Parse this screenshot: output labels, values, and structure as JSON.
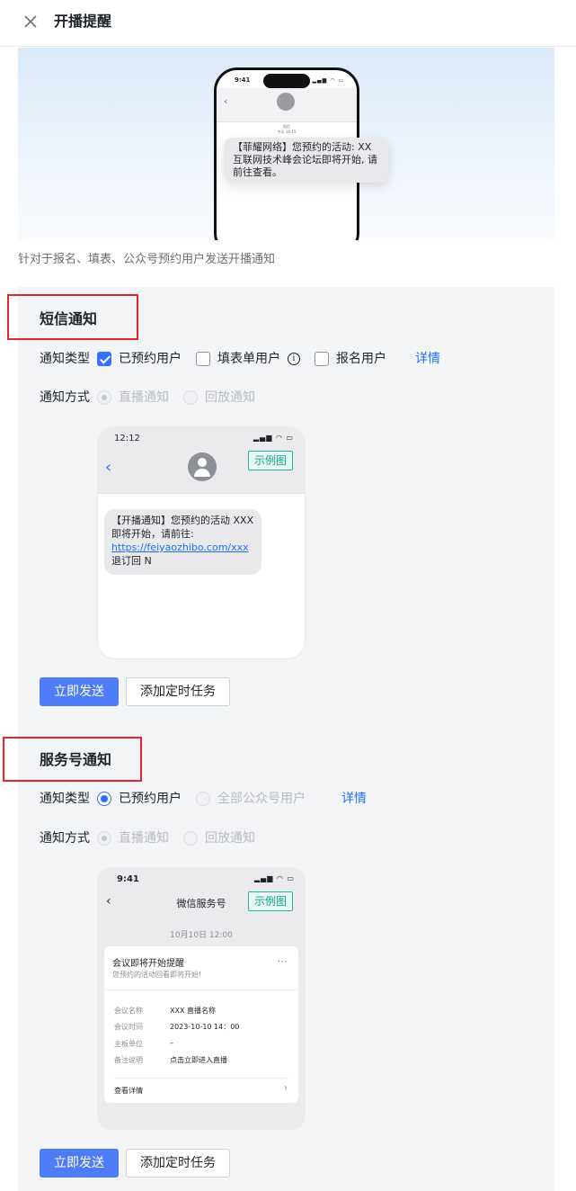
{
  "header": {
    "title": "开播提醒"
  },
  "banner": {
    "phone_time": "9:41",
    "signal_icons": "▂▄▆ ◠ ▭",
    "sender": "短信\n今天 14:15",
    "message": "【菲耀网络】您预约的活动: XX 互联网技术峰会论坛即将开始, 请前往查看。"
  },
  "subtitle": "针对于报名、填表、公众号预约用户发送开播通知",
  "sms": {
    "title": "短信通知",
    "type_label": "通知类型",
    "types": [
      {
        "label": "已预约用户",
        "checked": true
      },
      {
        "label": "填表单用户",
        "checked": false
      },
      {
        "label": "报名用户",
        "checked": false
      }
    ],
    "detail_link": "详情",
    "method_label": "通知方式",
    "methods": [
      {
        "label": "直播通知",
        "selected": true,
        "disabled": true
      },
      {
        "label": "回放通知",
        "selected": false,
        "disabled": true
      }
    ],
    "preview": {
      "time": "12:12",
      "signal_icons": "▂▄▆ ◠ ▭",
      "sample_tag": "示例图",
      "line1": "【开播通知】您预约的活动 XXX",
      "line2": "即将开始，请前往:",
      "url": "https://feiyaozhibo.com/xxx",
      "line4": "退订回 N"
    },
    "send_button": "立即发送",
    "schedule_button": "添加定时任务"
  },
  "service": {
    "title": "服务号通知",
    "type_label": "通知类型",
    "types": [
      {
        "label": "已预约用户",
        "selected": true,
        "disabled": false
      },
      {
        "label": "全部公众号用户",
        "selected": false,
        "disabled": true
      }
    ],
    "detail_link": "详情",
    "method_label": "通知方式",
    "methods": [
      {
        "label": "直播通知",
        "selected": true,
        "disabled": true
      },
      {
        "label": "回放通知",
        "selected": false,
        "disabled": true
      }
    ],
    "preview": {
      "time": "9:41",
      "signal_icons": "▂▄▆ ◠ ▭",
      "service_name": "微信服务号",
      "sample_tag": "示例图",
      "date": "10月10日 12:00",
      "card_title": "会议即将开始提醒",
      "card_subtitle": "您预约的活动回看即将开始!",
      "more": "···",
      "rows": [
        {
          "key": "会议名称",
          "value": "XXX 直播名称"
        },
        {
          "key": "会议时间",
          "value": "2023-10-10 14：00"
        },
        {
          "key": "主板单位",
          "value": "–"
        },
        {
          "key": "备注说明",
          "value": "点击立即进入直播"
        }
      ],
      "view_detail": "查看详情"
    },
    "send_button": "立即发送",
    "schedule_button": "添加定时任务"
  }
}
